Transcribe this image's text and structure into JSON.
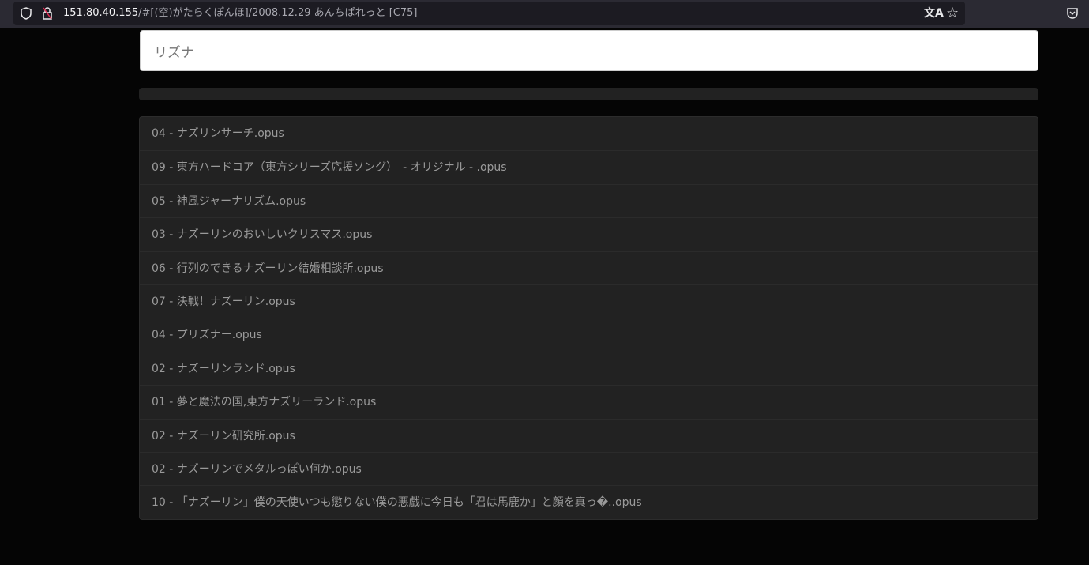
{
  "browser": {
    "url_host": "151.80.40.155",
    "url_rest": "/#[(空)がたらくぽんほ]/2008.12.29 あんちぱれっと [C75]",
    "icons": [
      "shield-icon",
      "insecure-lock-icon",
      "translate-icon",
      "star-bookmark-icon",
      "pocket-icon"
    ]
  },
  "search": {
    "value": "リズナ"
  },
  "progress": {
    "percent": 0
  },
  "tracks": [
    "04 - ナズリンサーチ.opus",
    "09 - 東方ハードコア（東方シリーズ応援ソング）　- オリジナル - .opus",
    "05 - 神風ジャーナリズム.opus",
    "03 - ナズーリンのおいしいクリスマス.opus",
    "06 - 行列のできるナズーリン結婚相談所.opus",
    "07 - 決戦！ナズーリン.opus",
    "04 - プリズナー.opus",
    "02 - ナズーリンランド.opus",
    "01 - 夢と魔法の国,東方ナズリーランド.opus",
    "02 - ナズーリン研究所.opus",
    "02 - ナズーリンでメタルっぽい何か.opus",
    "10 - 「ナズーリン」僕の天使いつも懲りない僕の悪戯に今日も「君は馬鹿か」と顔を真っ�..opus"
  ]
}
